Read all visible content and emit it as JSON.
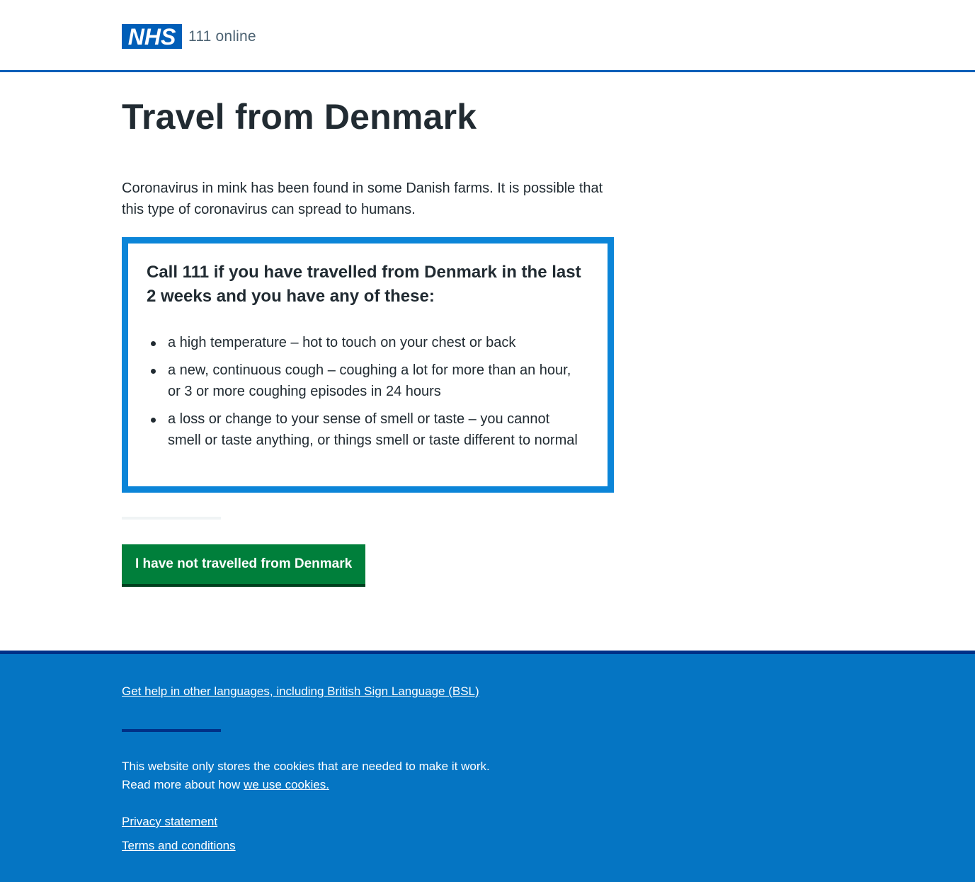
{
  "header": {
    "logo_text": "NHS",
    "service_name": "111 online"
  },
  "main": {
    "title": "Travel from Denmark",
    "intro": "Coronavirus in mink has been found in some Danish farms. It is possible that this type of coronavirus can spread to humans.",
    "callout": {
      "heading": "Call 111 if you have travelled from Denmark in the last 2 weeks and you have any of these:",
      "items": [
        "a high temperature – hot to touch on your chest or back",
        "a new, continuous cough – coughing a lot for more than an hour, or 3 or more coughing episodes in 24 hours",
        "a loss or change to your sense of smell or taste – you cannot smell or taste anything, or things smell or taste different to normal"
      ]
    },
    "button_label": "I have not travelled from Denmark"
  },
  "footer": {
    "language_link": "Get help in other languages, including British Sign Language (BSL)",
    "cookie_line1": "This website only stores the cookies that are needed to make it work.",
    "cookie_line2_prefix": "Read more about how ",
    "cookie_link": "we use cookies.",
    "privacy_link": "Privacy statement",
    "terms_link": "Terms and conditions"
  },
  "colors": {
    "nhs_blue": "#005eb8",
    "callout_border": "#0b85d8",
    "button_green": "#007f3b",
    "footer_background": "#0575c3",
    "footer_divider": "#003087"
  }
}
